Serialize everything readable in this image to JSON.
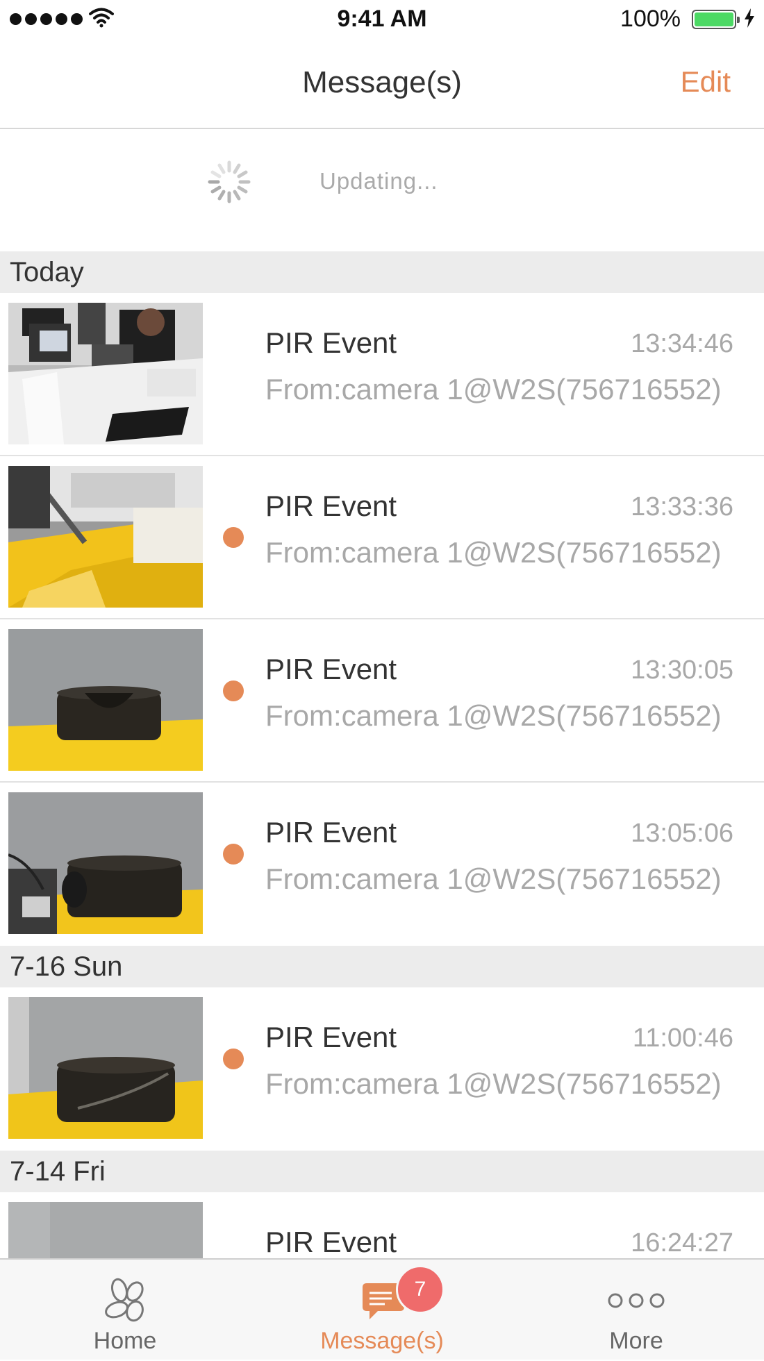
{
  "status_bar": {
    "time": "9:41 AM",
    "battery_percent": "100%",
    "battery_level": 1.0,
    "signal_icon": "signal-dots-icon",
    "wifi_icon": "wifi-icon",
    "charging_icon": "bolt-icon"
  },
  "nav": {
    "title": "Message(s)",
    "edit_label": "Edit"
  },
  "refresh": {
    "text": "Updating..."
  },
  "colors": {
    "accent": "#e58a57",
    "badge": "#ef6b6b",
    "section_bg": "#ececec"
  },
  "sections": [
    {
      "header": "Today",
      "events": [
        {
          "title": "PIR Event",
          "time": "13:34:46",
          "source": "From:camera 1@W2S(756716552)",
          "unread": false,
          "thumbnail": "office-desk-person"
        },
        {
          "title": "PIR Event",
          "time": "13:33:36",
          "source": "From:camera 1@W2S(756716552)",
          "unread": true,
          "thumbnail": "yellow-desk-shelf"
        },
        {
          "title": "PIR Event",
          "time": "13:30:05",
          "source": "From:camera 1@W2S(756716552)",
          "unread": true,
          "thumbnail": "black-device-yellow-table"
        },
        {
          "title": "PIR Event",
          "time": "13:05:06",
          "source": "From:camera 1@W2S(756716552)",
          "unread": true,
          "thumbnail": "black-device-with-cables"
        }
      ]
    },
    {
      "header": "7-16 Sun",
      "events": [
        {
          "title": "PIR Event",
          "time": "11:00:46",
          "source": "From:camera 1@W2S(756716552)",
          "unread": true,
          "thumbnail": "black-device-close-up"
        }
      ]
    },
    {
      "header": "7-14 Fri",
      "events": [
        {
          "title": "PIR Event",
          "time": "16:24:27",
          "source": "",
          "unread": false,
          "thumbnail": "gray-wall"
        }
      ]
    }
  ],
  "tabbar": {
    "tabs": [
      {
        "label": "Home",
        "icon": "home-petals-icon"
      },
      {
        "label": "Message(s)",
        "icon": "message-bubble-icon"
      },
      {
        "label": "More",
        "icon": "more-dots-icon"
      }
    ],
    "badge_count": "7"
  }
}
